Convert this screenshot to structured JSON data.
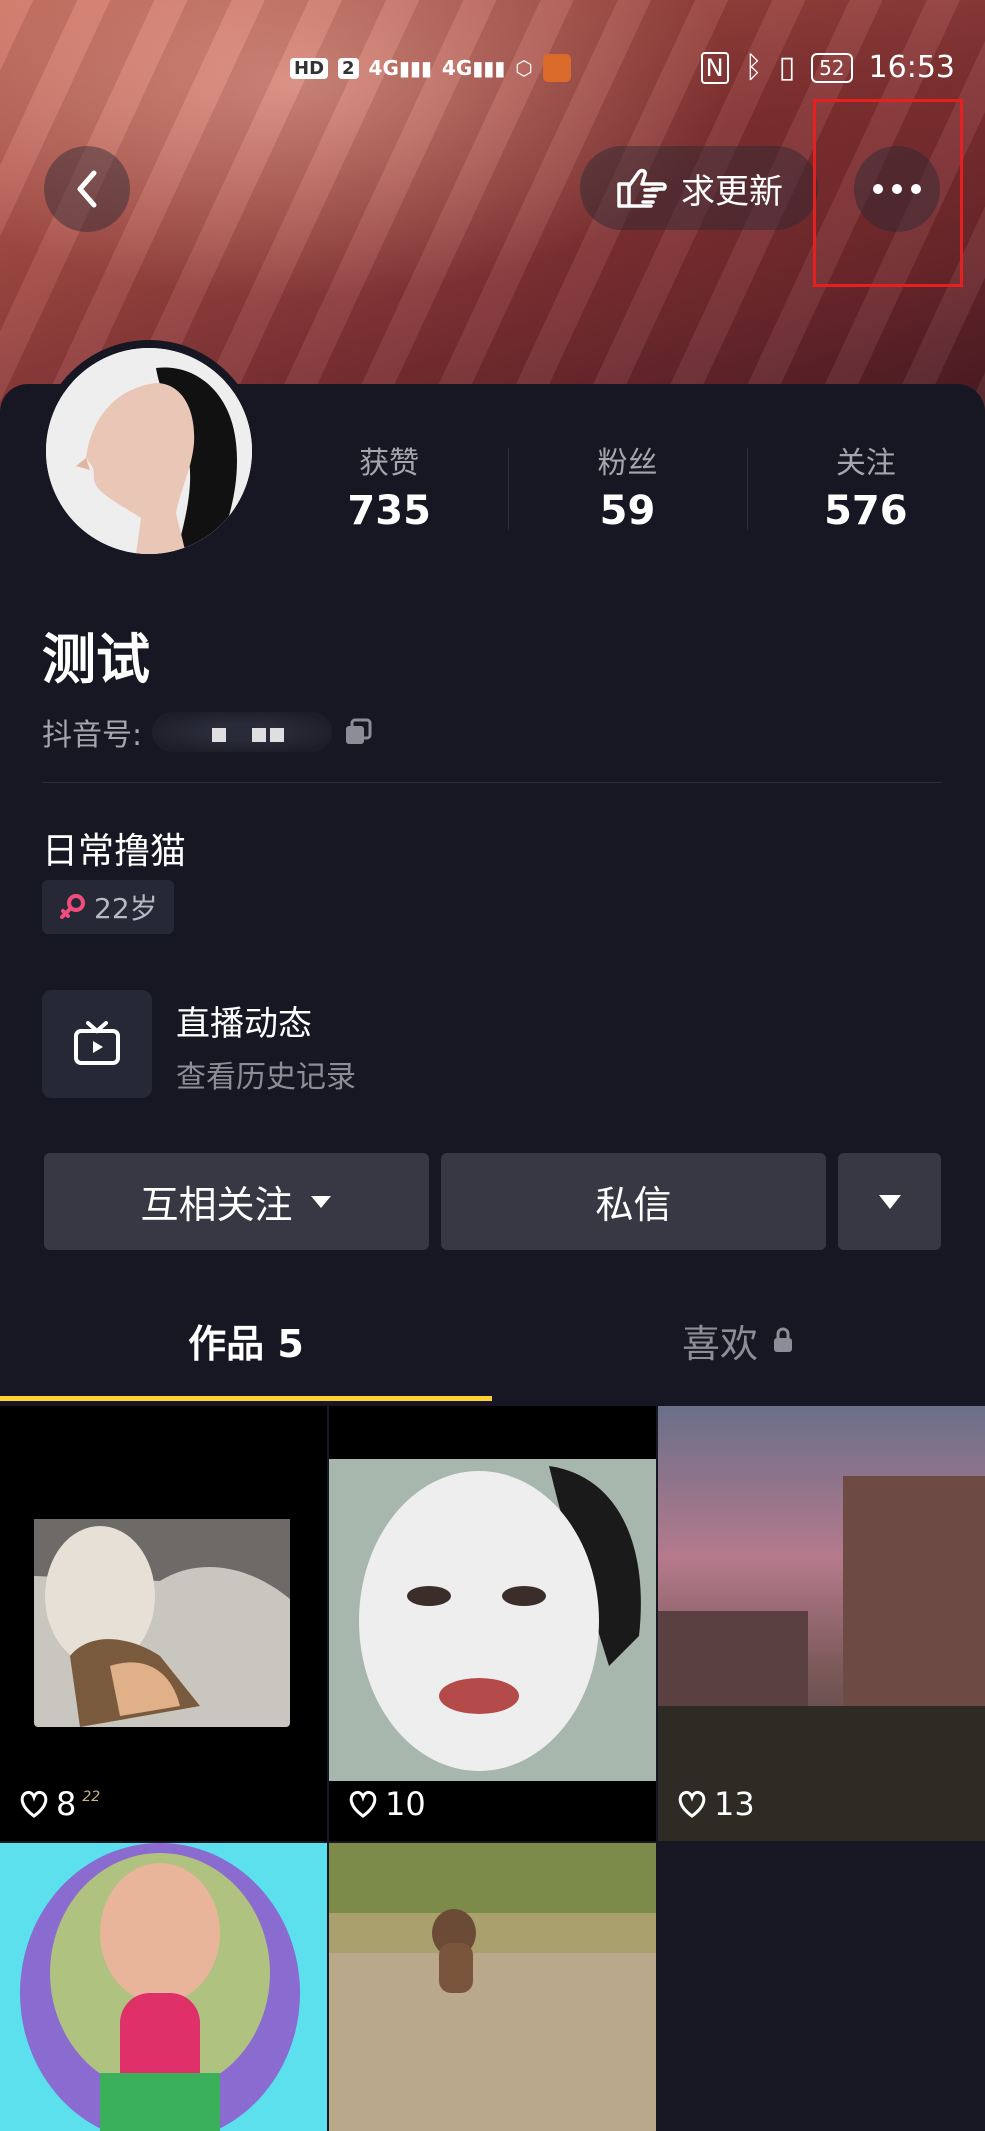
{
  "status_bar": {
    "network": "HD 2 4G 4G",
    "time": "16:53",
    "battery": "52"
  },
  "header": {
    "request_update_label": "求更新"
  },
  "profile": {
    "name": "测试",
    "douyin_id_label": "抖音号:",
    "bio": "日常撸猫",
    "age_tag": "22岁",
    "gender_color": "#f04c7c"
  },
  "stats": [
    {
      "label": "获赞",
      "value": "735"
    },
    {
      "label": "粉丝",
      "value": "59"
    },
    {
      "label": "关注",
      "value": "576"
    }
  ],
  "live": {
    "title": "直播动态",
    "subtitle": "查看历史记录"
  },
  "actions": {
    "follow_label": "互相关注",
    "message_label": "私信"
  },
  "tabs": [
    {
      "label": "作品 5"
    },
    {
      "label": "喜欢"
    }
  ],
  "videos": [
    {
      "likes": "8",
      "badge": "22"
    },
    {
      "likes": "10"
    },
    {
      "likes": "13"
    },
    {
      "likes": ""
    },
    {
      "likes": ""
    }
  ],
  "colors": {
    "accent": "#fdd22f",
    "background": "#161722",
    "highlight": "#e52020"
  }
}
